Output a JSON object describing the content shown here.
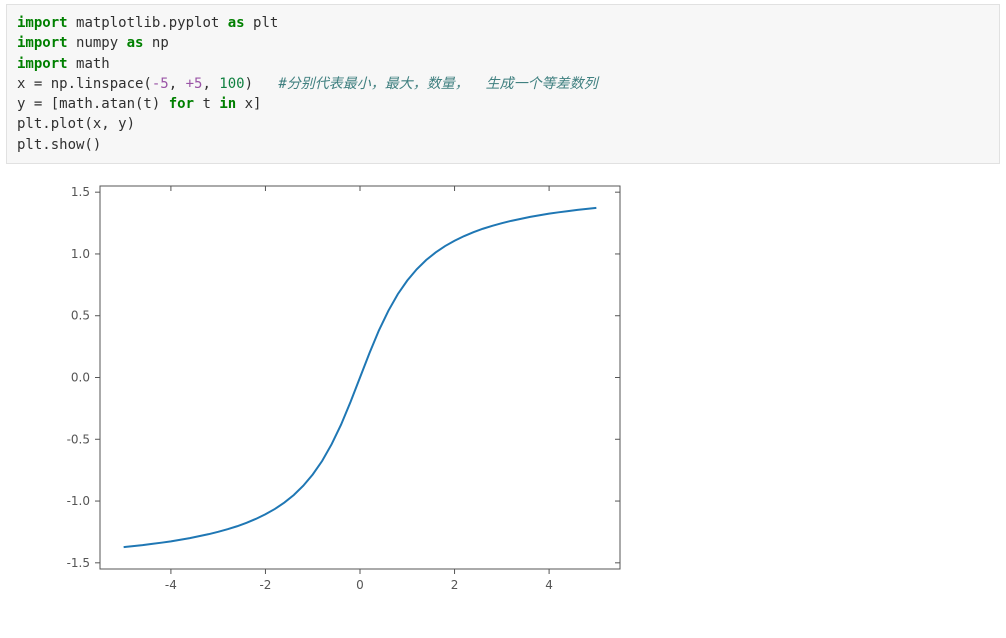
{
  "code": {
    "l1": {
      "kw1": "import",
      "mod": "matplotlib.pyplot",
      "kw2": "as",
      "alias": "plt"
    },
    "l2": {
      "kw1": "import",
      "mod": "numpy",
      "kw2": "as",
      "alias": "np"
    },
    "l3": {
      "kw1": "import",
      "mod": "math"
    },
    "l4": {
      "var": "x = np.linspace(",
      "n1": "-5",
      "c1": ", ",
      "n2": "+5",
      "c2": ", ",
      "n3": "100",
      "close": ")   ",
      "comment": "#分别代表最小，最大，数量，  生成一个等差数列"
    },
    "l5": {
      "a": "y = [math.atan(t) ",
      "kw1": "for",
      "b": " t ",
      "kw2": "in",
      "c": " x]"
    },
    "l6": {
      "txt": "plt.plot(x, y)"
    },
    "l7": {
      "txt": "plt.show()"
    }
  },
  "chart_data": {
    "type": "line",
    "x": [
      -5.0,
      -4.8,
      -4.6,
      -4.4,
      -4.2,
      -4.0,
      -3.8,
      -3.6,
      -3.4,
      -3.2,
      -3.0,
      -2.8,
      -2.6,
      -2.4,
      -2.2,
      -2.0,
      -1.8,
      -1.6,
      -1.4,
      -1.2,
      -1.0,
      -0.8,
      -0.6,
      -0.4,
      -0.2,
      0.0,
      0.2,
      0.4,
      0.6,
      0.8,
      1.0,
      1.2,
      1.4,
      1.6,
      1.8,
      2.0,
      2.2,
      2.4,
      2.6,
      2.8,
      3.0,
      3.2,
      3.4,
      3.6,
      3.8,
      4.0,
      4.2,
      4.4,
      4.6,
      4.8,
      5.0
    ],
    "y": [
      -1.373,
      -1.365,
      -1.357,
      -1.347,
      -1.337,
      -1.326,
      -1.313,
      -1.3,
      -1.284,
      -1.268,
      -1.249,
      -1.228,
      -1.204,
      -1.176,
      -1.144,
      -1.107,
      -1.064,
      -1.012,
      -0.951,
      -0.876,
      -0.785,
      -0.675,
      -0.54,
      -0.381,
      -0.197,
      0.0,
      0.197,
      0.381,
      0.54,
      0.675,
      0.785,
      0.876,
      0.951,
      1.012,
      1.064,
      1.107,
      1.144,
      1.176,
      1.204,
      1.228,
      1.249,
      1.268,
      1.284,
      1.3,
      1.313,
      1.326,
      1.337,
      1.347,
      1.357,
      1.365,
      1.373
    ],
    "xticks": [
      -4,
      -2,
      0,
      2,
      4
    ],
    "yticks": [
      -1.5,
      -1.0,
      -0.5,
      0.0,
      0.5,
      1.0,
      1.5
    ],
    "xtick_labels": [
      "-4",
      "-2",
      "0",
      "2",
      "4"
    ],
    "ytick_labels": [
      "-1.5",
      "-1.0",
      "-0.5",
      "0.0",
      "0.5",
      "1.0",
      "1.5"
    ],
    "xlim": [
      -5.5,
      5.5
    ],
    "ylim": [
      -1.55,
      1.55
    ],
    "title": "",
    "xlabel": "",
    "ylabel": ""
  }
}
